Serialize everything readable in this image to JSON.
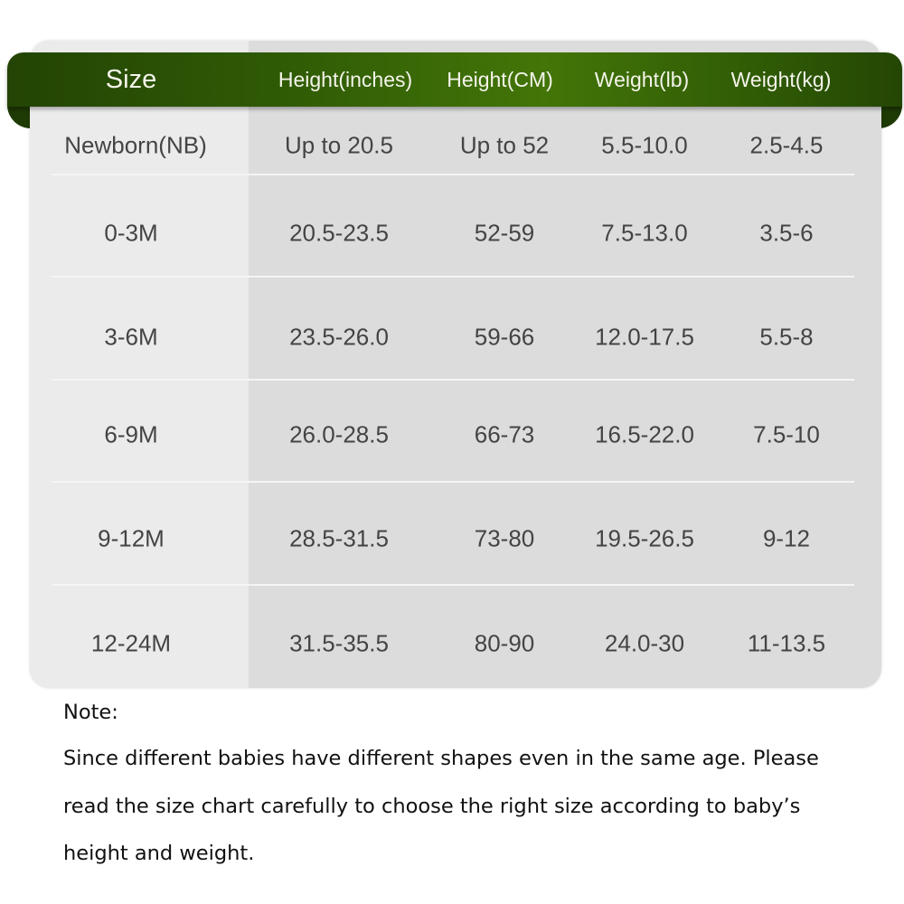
{
  "colors": {
    "header_green": "#2f5a05",
    "header_text": "#f4f4ea",
    "body_text": "#444444",
    "first_column_bg": "#ebebeb",
    "table_bg": "#dcdcdc"
  },
  "table": {
    "headers": [
      "Size",
      "Height(inches)",
      "Height(CM)",
      "Weight(lb)",
      "Weight(kg)"
    ],
    "rows": [
      [
        "Newborn(NB)",
        "Up to 20.5",
        "Up to 52",
        "5.5-10.0",
        "2.5-4.5"
      ],
      [
        "0-3M",
        "20.5-23.5",
        "52-59",
        "7.5-13.0",
        "3.5-6"
      ],
      [
        "3-6M",
        "23.5-26.0",
        "59-66",
        "12.0-17.5",
        "5.5-8"
      ],
      [
        "6-9M",
        "26.0-28.5",
        "66-73",
        "16.5-22.0",
        "7.5-10"
      ],
      [
        "9-12M",
        "28.5-31.5",
        "73-80",
        "19.5-26.5",
        "9-12"
      ],
      [
        "12-24M",
        "31.5-35.5",
        "80-90",
        "24.0-30",
        "11-13.5"
      ]
    ]
  },
  "note": {
    "title": "Note:",
    "lines": [
      "Since different babies have different shapes even in the same age. Please",
      "read the size chart carefully to choose the right size according to baby’s",
      "height and weight."
    ]
  }
}
